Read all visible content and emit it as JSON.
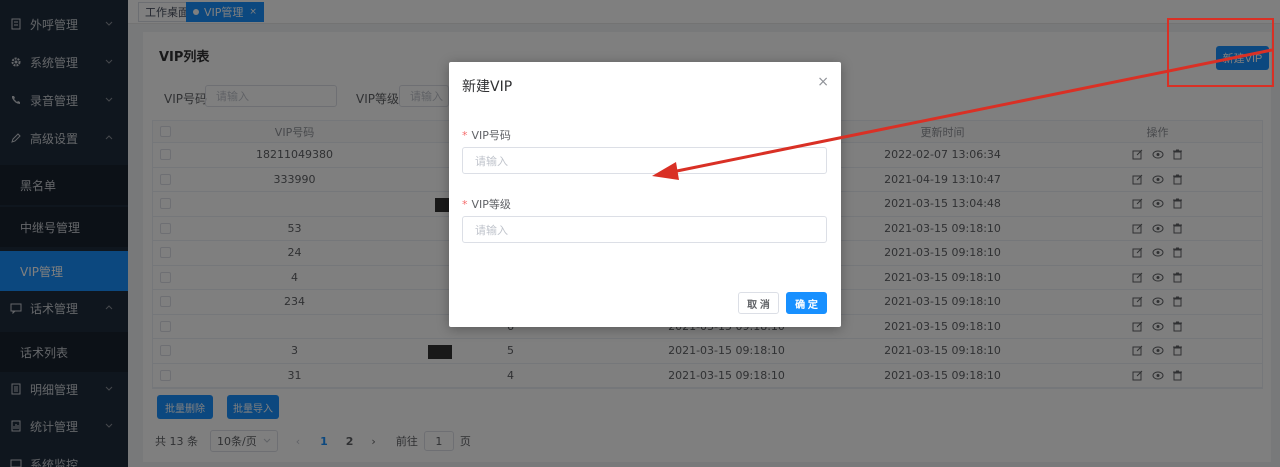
{
  "sidebar": {
    "items": [
      {
        "label": "外呼管理",
        "icon": "document-icon"
      },
      {
        "label": "系统管理",
        "icon": "gear-icon"
      },
      {
        "label": "录音管理",
        "icon": "phone-icon"
      },
      {
        "label": "高级设置",
        "icon": "pencil-icon"
      },
      {
        "label": "话术管理",
        "icon": "chat-icon"
      },
      {
        "label": "明细管理",
        "icon": "list-icon"
      },
      {
        "label": "统计管理",
        "icon": "chart-icon"
      },
      {
        "label": "系统监控",
        "icon": "monitor-icon"
      }
    ],
    "sub_items": [
      "黑名单",
      "中继号管理",
      "VIP管理",
      "话术列表"
    ]
  },
  "tabs": [
    {
      "label": "工作桌面"
    },
    {
      "label": "VIP管理",
      "close": "×"
    }
  ],
  "page": {
    "title": "VIP列表",
    "new_button": "新建VIP",
    "filter_vip_no_label": "VIP号码",
    "filter_vip_no_placeholder": "请输入",
    "filter_vip_level_label": "VIP等级",
    "filter_vip_level_placeholder": "请输入"
  },
  "table": {
    "headers": [
      "VIP号码",
      "",
      "",
      "更新时间",
      "操作"
    ],
    "rows": [
      {
        "vip": "18211049380",
        "level": "",
        "created": "",
        "updated": "2022-02-07 13:06:34"
      },
      {
        "vip": "333990",
        "level": "",
        "created": "",
        "updated": "2021-04-19 13:10:47"
      },
      {
        "vip": "",
        "level": "",
        "created": "",
        "updated": "2021-03-15 13:04:48"
      },
      {
        "vip": "53",
        "level": "",
        "created": "",
        "updated": "2021-03-15 09:18:10"
      },
      {
        "vip": "24",
        "level": "",
        "created": "",
        "updated": "2021-03-15 09:18:10"
      },
      {
        "vip": "4",
        "level": "",
        "created": "",
        "updated": "2021-03-15 09:18:10"
      },
      {
        "vip": "234",
        "level": "",
        "created": "",
        "updated": "2021-03-15 09:18:10"
      },
      {
        "vip": "",
        "level": "6",
        "created": "2021-03-15 09:18:10",
        "updated": "2021-03-15 09:18:10"
      },
      {
        "vip": "3",
        "level": "5",
        "created": "2021-03-15 09:18:10",
        "updated": "2021-03-15 09:18:10"
      },
      {
        "vip": "31",
        "level": "4",
        "created": "2021-03-15 09:18:10",
        "updated": "2021-03-15 09:18:10"
      }
    ]
  },
  "bulk": {
    "delete": "批量删除",
    "import": "批量导入"
  },
  "pager": {
    "total": "共 13 条",
    "page_size": "10条/页",
    "pages": [
      "1",
      "2"
    ],
    "goto_label": "前往",
    "goto_value": "1",
    "page_unit": "页"
  },
  "dialog": {
    "title": "新建VIP",
    "close": "×",
    "field1_label": "VIP号码",
    "field1_placeholder": "请输入",
    "field2_label": "VIP等级",
    "field2_placeholder": "请输入",
    "required_mark": "*",
    "cancel": "取 消",
    "confirm": "确 定"
  },
  "colors": {
    "accent": "#1890ff",
    "sidebar": "#1f2d3d",
    "annotation": "#d93025"
  }
}
